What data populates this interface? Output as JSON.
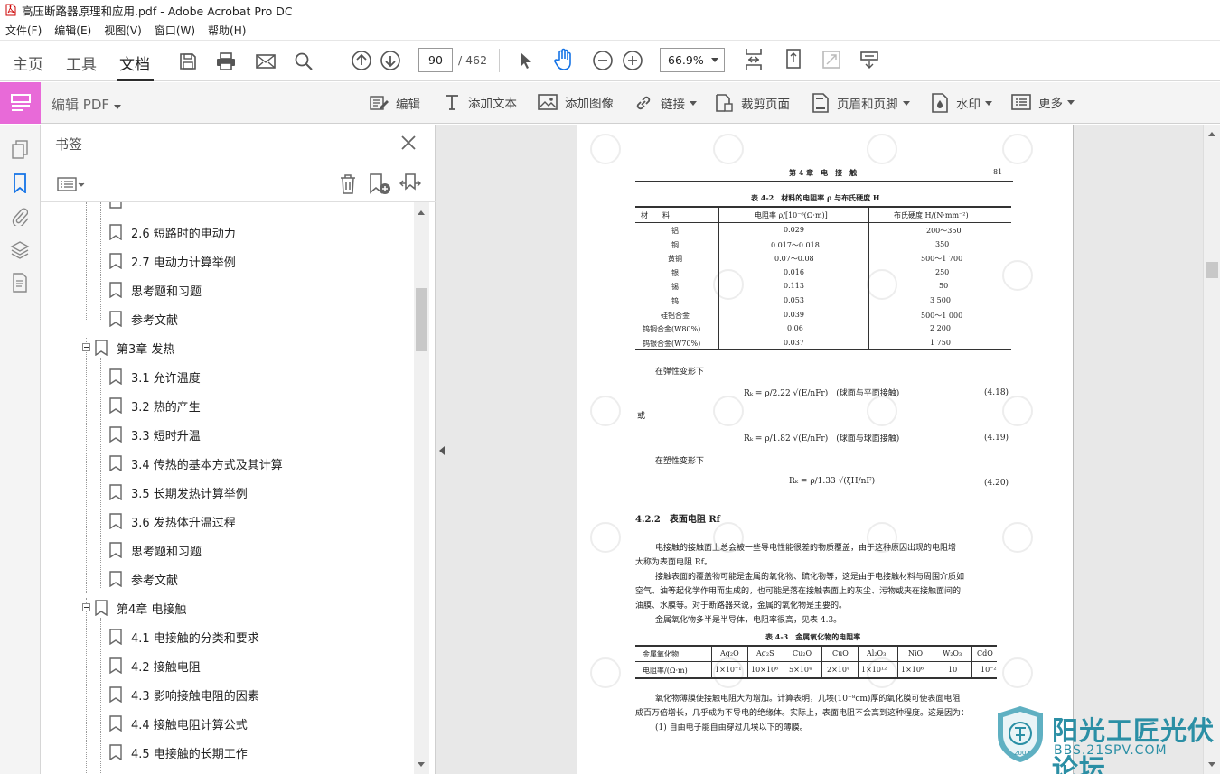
{
  "window": {
    "title": "高压断路器原理和应用.pdf - Adobe Acrobat Pro DC"
  },
  "menu": [
    "文件(F)",
    "编辑(E)",
    "视图(V)",
    "窗口(W)",
    "帮助(H)"
  ],
  "toolbar": {
    "tabs": [
      "主页",
      "工具",
      "文档"
    ],
    "page_current": "90",
    "page_total": "/ 462",
    "zoom": "66.9%"
  },
  "editbar": {
    "title": "编辑 PDF",
    "buttons": [
      "编辑",
      "添加文本",
      "添加图像",
      "链接",
      "裁剪页面",
      "页眉和页脚",
      "水印",
      "更多"
    ]
  },
  "bookmarks": {
    "title": "书签",
    "items": [
      {
        "label": "2.6 短路时的电动力",
        "level": 2
      },
      {
        "label": "2.7 电动力计算举例",
        "level": 2
      },
      {
        "label": "思考题和习题",
        "level": 2
      },
      {
        "label": "参考文献",
        "level": 2
      },
      {
        "label": "第3章 发热",
        "level": 1
      },
      {
        "label": "3.1 允许温度",
        "level": 2
      },
      {
        "label": "3.2 热的产生",
        "level": 2
      },
      {
        "label": "3.3 短时升温",
        "level": 2
      },
      {
        "label": "3.4 传热的基本方式及其计算",
        "level": 2
      },
      {
        "label": "3.5 长期发热计算举例",
        "level": 2
      },
      {
        "label": "3.6 发热体升温过程",
        "level": 2
      },
      {
        "label": "思考题和习题",
        "level": 2
      },
      {
        "label": "参考文献",
        "level": 2
      },
      {
        "label": "第4章 电接触",
        "level": 1
      },
      {
        "label": "4.1 电接触的分类和要求",
        "level": 2
      },
      {
        "label": "4.2 接触电阻",
        "level": 2
      },
      {
        "label": "4.3 影响接触电阻的因素",
        "level": 2
      },
      {
        "label": "4.4 接触电阻计算公式",
        "level": 2
      },
      {
        "label": "4.5 电接触的长期工作",
        "level": 2
      }
    ]
  },
  "pdf_page": {
    "header_chapter": "第 4 章　电　接　触",
    "header_page": "81",
    "table1_title": "表 4-2　材料的电阻率 ρ 与布氏硬度 H",
    "table1_cols": [
      "材　　料",
      "电阻率 ρ/[10⁻⁶(Ω·m)]",
      "布氏硬度 H/(N·mm⁻²)"
    ],
    "table1_rows": [
      [
        "铝",
        "0.029",
        "200～350"
      ],
      [
        "铜",
        "0.017～0.018",
        "350"
      ],
      [
        "黄铜",
        "0.07～0.08",
        "500～1 700"
      ],
      [
        "银",
        "0.016",
        "250"
      ],
      [
        "锡",
        "0.113",
        "50"
      ],
      [
        "钨",
        "0.053",
        "3 500"
      ],
      [
        "硅铝合金",
        "0.039",
        "500～1 000"
      ],
      [
        "钨铜合金(W80%)",
        "0.06",
        "2 200"
      ],
      [
        "钨银合金(W70%)",
        "0.037",
        "1 750"
      ]
    ],
    "text_elastic": "在弹性变形下",
    "eq1": "Rₖ = ρ/2.22 √(E/nFr)　(球面与平面接触)",
    "eq1_no": "(4.18)",
    "text_or": "或",
    "eq2": "Rₖ = ρ/1.82 √(E/nFr)　(球面与球面接触)",
    "eq2_no": "(4.19)",
    "text_plastic": "在塑性变形下",
    "eq3": "Rₖ = ρ/1.33 √(ξH/nF)",
    "eq3_no": "(4.20)",
    "section": "4.2.2　表面电阻 Rf",
    "para1a": "电接触的接触面上总会被一些导电性能很差的物质覆盖，由于这种原因出现的电阻增",
    "para1b": "大称为表面电阻 Rf。",
    "para2a": "接触表面的覆盖物可能是金属的氧化物、硫化物等，这是由于电接触材料与周围介质如",
    "para2b": "空气、油等起化学作用而生成的，也可能是落在接触表面上的灰尘、污物或夹在接触面间的",
    "para2c": "油膜、水膜等。对于断路器来说，金属的氧化物是主要的。",
    "para3": "金属氧化物多半是半导体，电阻率很高，见表 4.3。",
    "table2_title": "表 4-3　金属氧化物的电阻率",
    "table2_head": [
      "金属氧化物",
      "Ag₂O",
      "Ag₂S",
      "Cu₂O",
      "CuO",
      "Al₂O₃",
      "NiO",
      "W₂O₃",
      "CdO"
    ],
    "table2_row": [
      "电阻率/(Ω·m)",
      "1×10⁻¹",
      "10×10⁶",
      "5×10⁴",
      "2×10⁴",
      "1×10¹²",
      "1×10⁶",
      "10",
      "10⁻²"
    ],
    "para4a": "氧化物薄膜使接触电阻大为增加。计算表明，几埃(10⁻⁸cm)厚的氧化膜可使表面电阻",
    "para4b": "成百万倍增长，几乎成为不导电的绝缘体。实际上，表面电阻不会高到这种程度。这是因为：",
    "para5": "(1) 自由电子能自由穿过几埃以下的薄膜。"
  },
  "logo": {
    "name": "阳光工匠光伏论坛",
    "url": "BBS.21SPV.COM",
    "year": "2007"
  },
  "colors": {
    "accent_pink": "#e86ad8",
    "logo_teal": "#2b8fa5"
  }
}
